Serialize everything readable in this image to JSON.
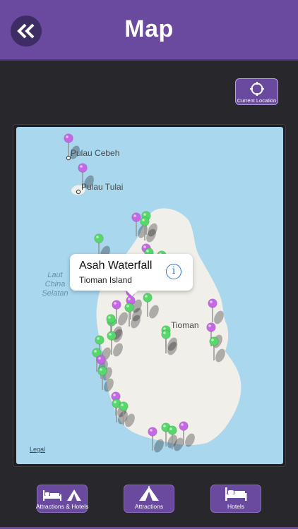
{
  "header": {
    "title": "Map"
  },
  "controls": {
    "current_location_label": "Current Location"
  },
  "map": {
    "places": {
      "pulau_cebeh": "Pulau Cebeh",
      "pulau_tulai": "Pulau Tulai",
      "tioman": "Tioman",
      "laut_line1": "Laut",
      "laut_line2": "China",
      "laut_line3": "Selatan"
    },
    "callout": {
      "title": "Asah Waterfall",
      "subtitle": "Tioman Island",
      "info_glyph": "i"
    },
    "legal": "Legal"
  },
  "tabs": [
    {
      "label": "Attractions & Hotels"
    },
    {
      "label": "Attractions"
    },
    {
      "label": "Hotels"
    }
  ],
  "colors": {
    "accent": "#6a4a9f",
    "pin_attraction": "#56d86a",
    "pin_hotel": "#c468e6",
    "sea": "#a8d7ee",
    "land": "#f0efea"
  }
}
